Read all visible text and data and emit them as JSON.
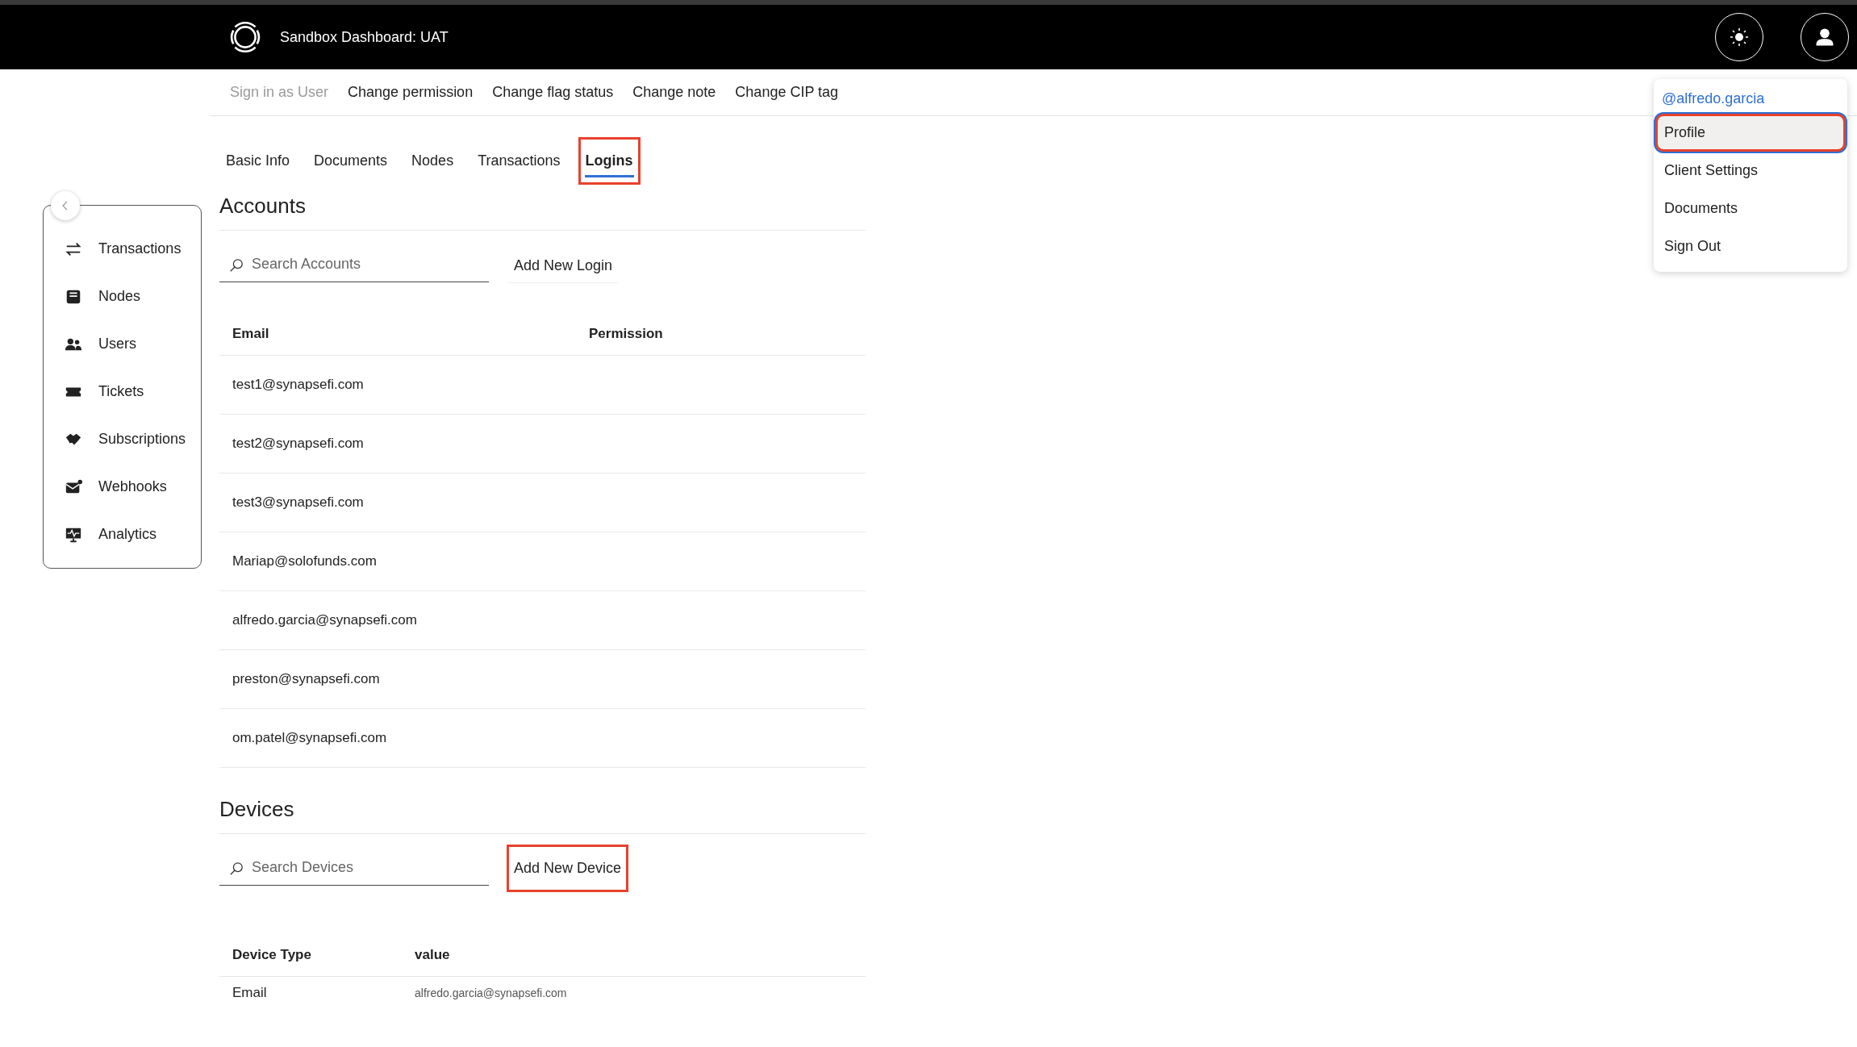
{
  "header": {
    "title": "Sandbox Dashboard: UAT"
  },
  "actions": [
    {
      "label": "Sign in as User",
      "disabled": true
    },
    {
      "label": "Change permission",
      "disabled": false
    },
    {
      "label": "Change flag status",
      "disabled": false
    },
    {
      "label": "Change note",
      "disabled": false
    },
    {
      "label": "Change CIP tag",
      "disabled": false
    }
  ],
  "tabs": [
    {
      "label": "Basic Info",
      "selected": false,
      "highlighted": false
    },
    {
      "label": "Documents",
      "selected": false,
      "highlighted": false
    },
    {
      "label": "Nodes",
      "selected": false,
      "highlighted": false
    },
    {
      "label": "Transactions",
      "selected": false,
      "highlighted": false
    },
    {
      "label": "Logins",
      "selected": true,
      "highlighted": true
    }
  ],
  "sidebar": {
    "items": [
      {
        "label": "Transactions"
      },
      {
        "label": "Nodes"
      },
      {
        "label": "Users"
      },
      {
        "label": "Tickets"
      },
      {
        "label": "Subscriptions"
      },
      {
        "label": "Webhooks"
      },
      {
        "label": "Analytics"
      }
    ]
  },
  "accounts": {
    "title": "Accounts",
    "search": {
      "placeholder": "Search Accounts"
    },
    "add_button": {
      "label": "Add New Login",
      "highlighted": false
    },
    "columns": [
      "Email",
      "Permission"
    ],
    "rows": [
      {
        "email": "test1@synapsefi.com"
      },
      {
        "email": "test2@synapsefi.com"
      },
      {
        "email": "test3@synapsefi.com"
      },
      {
        "email": "Mariap@solofunds.com"
      },
      {
        "email": "alfredo.garcia@synapsefi.com"
      },
      {
        "email": "preston@synapsefi.com"
      },
      {
        "email": "om.patel@synapsefi.com"
      }
    ]
  },
  "devices": {
    "title": "Devices",
    "search": {
      "placeholder": "Search Devices"
    },
    "add_button": {
      "label": "Add New Device",
      "highlighted": true
    },
    "columns": [
      "Device Type",
      "value"
    ],
    "rows": [
      {
        "device_type": "Email",
        "value": "alfredo.garcia@synapsefi.com"
      }
    ]
  },
  "user_menu": {
    "username": "@alfredo.garcia",
    "items": [
      {
        "label": "Profile",
        "selected": true,
        "highlighted": true
      },
      {
        "label": "Client Settings",
        "selected": false,
        "highlighted": false
      },
      {
        "label": "Documents",
        "selected": false,
        "highlighted": false
      },
      {
        "label": "Sign Out",
        "selected": false,
        "highlighted": false
      }
    ]
  }
}
